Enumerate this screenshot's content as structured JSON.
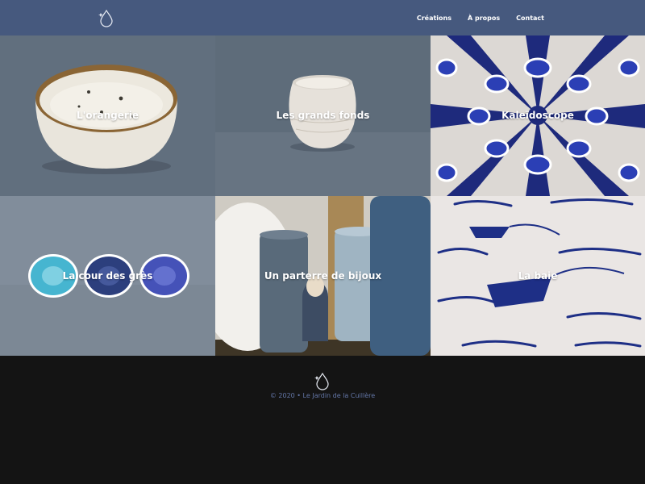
{
  "header": {
    "nav": [
      {
        "label": "Créations"
      },
      {
        "label": "À propos"
      },
      {
        "label": "Contact"
      }
    ],
    "logo_icon": "droplet-with-sparkle-icon"
  },
  "gallery": {
    "tiles": [
      {
        "title": "L'orangerie"
      },
      {
        "title": "Les grands fonds"
      },
      {
        "title": "Kaleïdoscope"
      },
      {
        "title": "La cour des grès"
      },
      {
        "title": "Un parterre de bijoux"
      },
      {
        "title": "La baie"
      }
    ]
  },
  "footer": {
    "copyright": "© 2020 • Le Jardin de la Cuillère",
    "logo_icon": "droplet-with-sparkle-icon"
  },
  "colors": {
    "header_bg": "#46597e",
    "footer_bg": "#141414",
    "copyright_text": "#6477a8"
  }
}
